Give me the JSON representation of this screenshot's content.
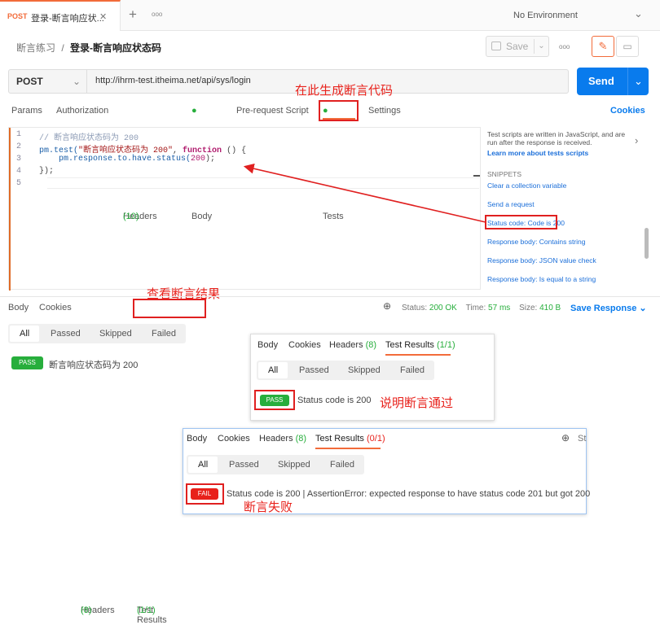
{
  "tab": {
    "method": "POST",
    "title": "登录-断言响应状...",
    "close": "✕",
    "add": "+",
    "more": "ooo"
  },
  "env": {
    "label": "No Environment",
    "chev": "⌄"
  },
  "breadcrumb": {
    "parent": "断言练习",
    "sep": "/",
    "current": "登录-断言响应状态码"
  },
  "toolbar": {
    "save": "Save",
    "more": "ooo"
  },
  "request": {
    "method": "POST",
    "url": "http://ihrm-test.itheima.net/api/sys/login",
    "send": "Send"
  },
  "req_tabs": {
    "params": "Params",
    "authorization": "Authorization",
    "headers": "Headers",
    "headers_count": "(10)",
    "body": "Body",
    "prereq": "Pre-request Script",
    "tests": "Tests",
    "settings": "Settings",
    "cookies": "Cookies"
  },
  "code": {
    "lines": [
      "1",
      "2",
      "3",
      "4",
      "5"
    ],
    "l1": "// 断言响应状态码为 200",
    "l2a": "pm.test(",
    "l2b": "\"断言响应状态码为 200\"",
    "l2c": ", ",
    "l2d": "function",
    "l2e": " () {",
    "l3a": "    pm.response.to.have.status(",
    "l3b": "200",
    "l3c": ");",
    "l4": "});"
  },
  "side": {
    "desc": "Test scripts are written in JavaScript, and are run after the response is received.",
    "learn": "Learn more about tests scripts",
    "snippets": "SNIPPETS",
    "items": [
      "Clear a collection variable",
      "Send a request",
      "Status code: Code is 200",
      "Response body: Contains string",
      "Response body: JSON value check",
      "Response body: Is equal to a string"
    ]
  },
  "annotations": {
    "gen": "在此生成断言代码",
    "view": "查看断言结果",
    "passed": "说明断言通过",
    "failed": "断言失败"
  },
  "res_tabs": {
    "body": "Body",
    "cookies": "Cookies",
    "headers": "Headers",
    "headers_count": "(8)",
    "test_results": "Test Results",
    "count": "(1/1)"
  },
  "status": {
    "status_label": "Status:",
    "status": "200 OK",
    "time_label": "Time:",
    "time": "57 ms",
    "size_label": "Size:",
    "size": "410 B",
    "save": "Save Response"
  },
  "filters": {
    "all": "All",
    "passed": "Passed",
    "skipped": "Skipped",
    "failed": "Failed"
  },
  "result": {
    "badge": "PASS",
    "text": "断言响应状态码为 200"
  },
  "popup1": {
    "body": "Body",
    "cookies": "Cookies",
    "headers": "Headers",
    "headers_count": "(8)",
    "test_results": "Test Results",
    "count": "(1/1)",
    "badge": "PASS",
    "text": "Status code is 200"
  },
  "popup2": {
    "body": "Body",
    "cookies": "Cookies",
    "headers": "Headers",
    "headers_count": "(8)",
    "test_results": "Test Results",
    "count": "(0/1)",
    "badge": "FAIL",
    "text": "Status code is 200 | AssertionError: expected response to have status code 201 but got 200",
    "st": "St"
  },
  "colors": {
    "accent": "#f26b3a",
    "send": "#097bed",
    "pass": "#27ae3c",
    "fail": "#e8211b",
    "annotation": "#e8221c"
  }
}
